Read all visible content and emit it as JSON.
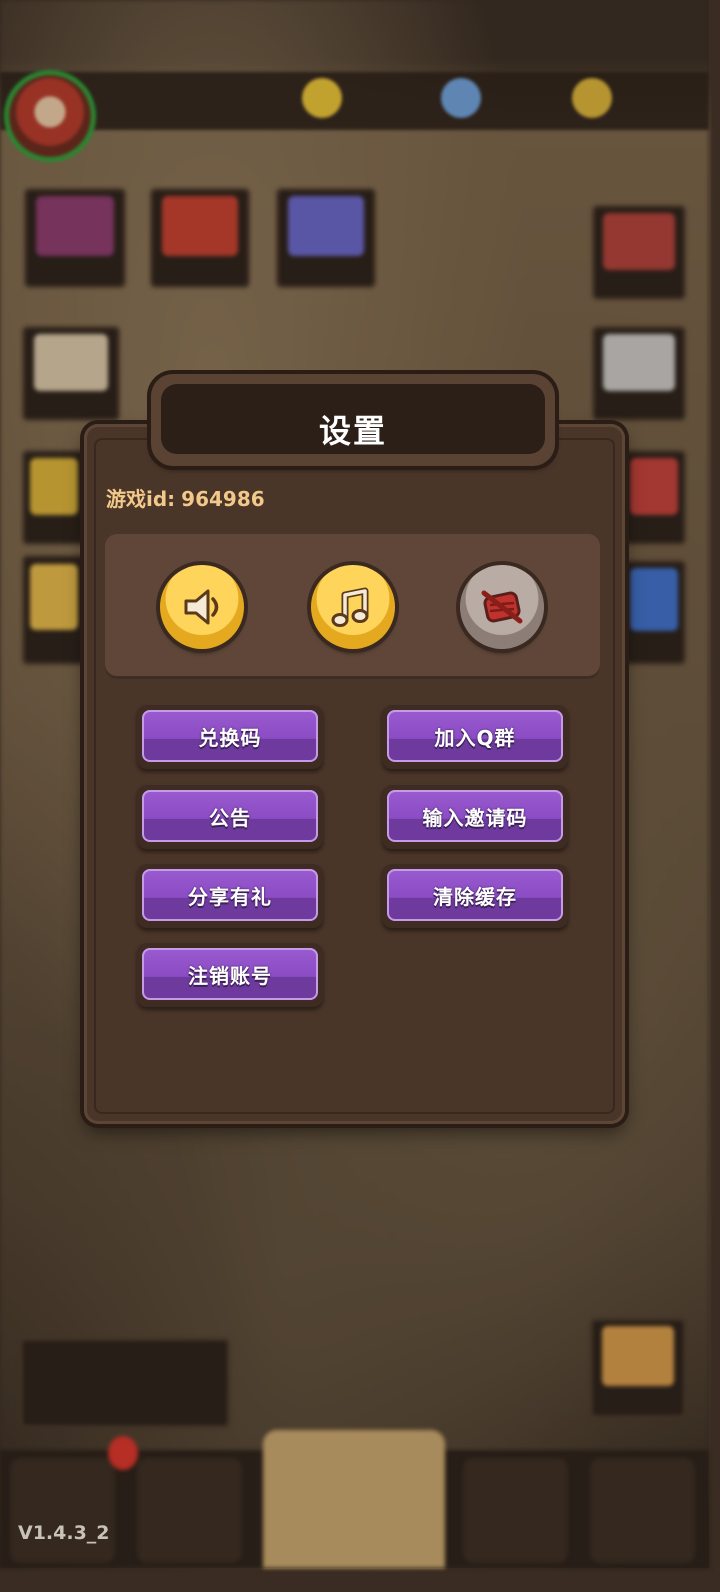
{
  "dialog": {
    "title": "设置",
    "game_id_label": "游戏id:",
    "game_id_value": "964986"
  },
  "sound_buttons": [
    {
      "name": "sound-toggle",
      "icon": "speaker-icon",
      "state": "on"
    },
    {
      "name": "music-toggle",
      "icon": "music-note-icon",
      "state": "on"
    },
    {
      "name": "vibration-toggle",
      "icon": "vibration-off-icon",
      "state": "off"
    }
  ],
  "buttons": {
    "redeem_code": "兑换码",
    "join_q_group": "加入Q群",
    "announcement": "公告",
    "enter_invite_code": "输入邀请码",
    "share_gift": "分享有礼",
    "clear_cache": "清除缓存",
    "delete_account": "注销账号"
  },
  "version": "V1.4.3_2",
  "colors": {
    "dialog_bg": "#4a3529",
    "button_purple": "#8b4cc4",
    "toggle_gold": "#ffd45a",
    "toggle_off_gray": "#b9aca4",
    "game_id_text": "#f2c98a"
  }
}
